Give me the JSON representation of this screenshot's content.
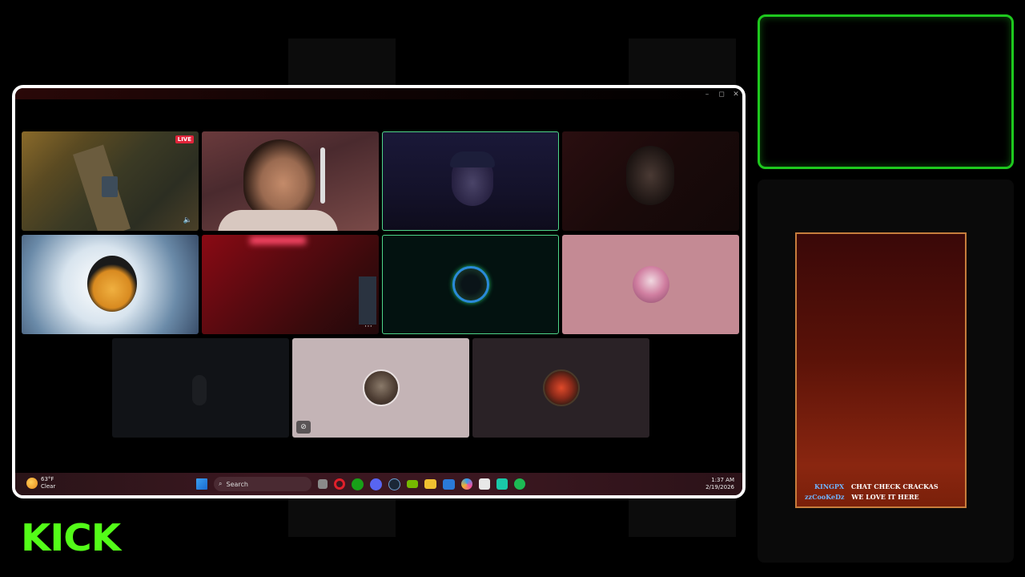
{
  "brand": {
    "logo_text": "KICK",
    "accent": "#53fc18"
  },
  "capture_window": {
    "controls": [
      "–",
      "◻",
      "✕"
    ]
  },
  "call_grid": {
    "tiles": [
      {
        "id": "game-stream",
        "live_badge": "LIVE",
        "active": false
      },
      {
        "id": "participant-2",
        "active": false
      },
      {
        "id": "participant-3",
        "active": true
      },
      {
        "id": "participant-4",
        "active": false
      },
      {
        "id": "participant-5",
        "active": false
      },
      {
        "id": "participant-6",
        "active": false
      },
      {
        "id": "participant-7",
        "active": true
      },
      {
        "id": "participant-8",
        "active": false
      },
      {
        "id": "participant-9",
        "active": false
      },
      {
        "id": "participant-10",
        "active": false
      },
      {
        "id": "participant-11",
        "active": false
      }
    ]
  },
  "taskbar": {
    "weather_temp": "63°F",
    "weather_cond": "Clear",
    "search_label": "Search",
    "time": "1:37 AM",
    "date": "2/19/2026",
    "icons": [
      "windows-icon",
      "search-icon",
      "task-view-icon",
      "opera-icon",
      "xbox-icon",
      "discord-icon",
      "steam-icon",
      "nvidia-icon",
      "file-explorer-icon",
      "mail-icon",
      "copilot-icon",
      "store-icon",
      "app-icon",
      "spotify-icon"
    ]
  },
  "chat": {
    "messages": [
      {
        "user": "KINGPX",
        "text": "CHAT CHECK CRACKAS"
      },
      {
        "user": "zzCooKeDz",
        "text": "WE LOVE IT HERE"
      }
    ]
  }
}
